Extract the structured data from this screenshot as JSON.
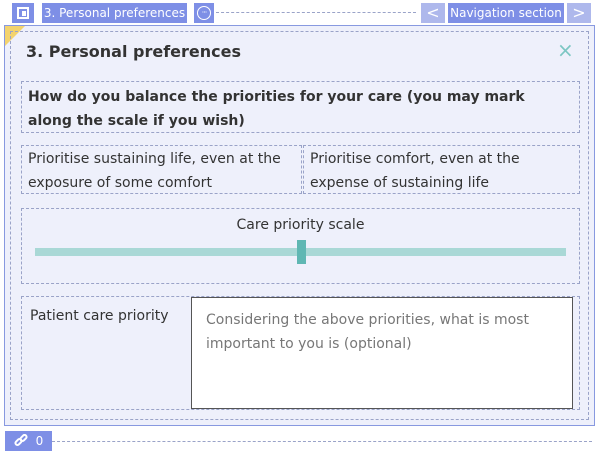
{
  "toolbar": {
    "section_label": "3. Personal preferences",
    "nav_label": "Navigation section",
    "prev_glyph": "<",
    "next_glyph": ">"
  },
  "panel": {
    "title": "3. Personal preferences",
    "close_glyph": "×"
  },
  "question": "How do you balance the priorities for your care (you may mark along the scale if you wish)",
  "options": {
    "left": "Prioritise sustaining life, even at the exposure of some comfort",
    "right": "Prioritise comfort, even at the expense of sustaining life"
  },
  "scale": {
    "label": "Care priority scale",
    "value": 0.5
  },
  "care_priority": {
    "label": "Patient care priority",
    "placeholder": "Considering the above priorities, what is most important to you is (optional)"
  },
  "bottom": {
    "count": "0"
  },
  "colors": {
    "accent": "#7e8fe6",
    "teal": "#5fb7b3",
    "track": "#a9d8d6",
    "corner": "#f3d36e"
  }
}
